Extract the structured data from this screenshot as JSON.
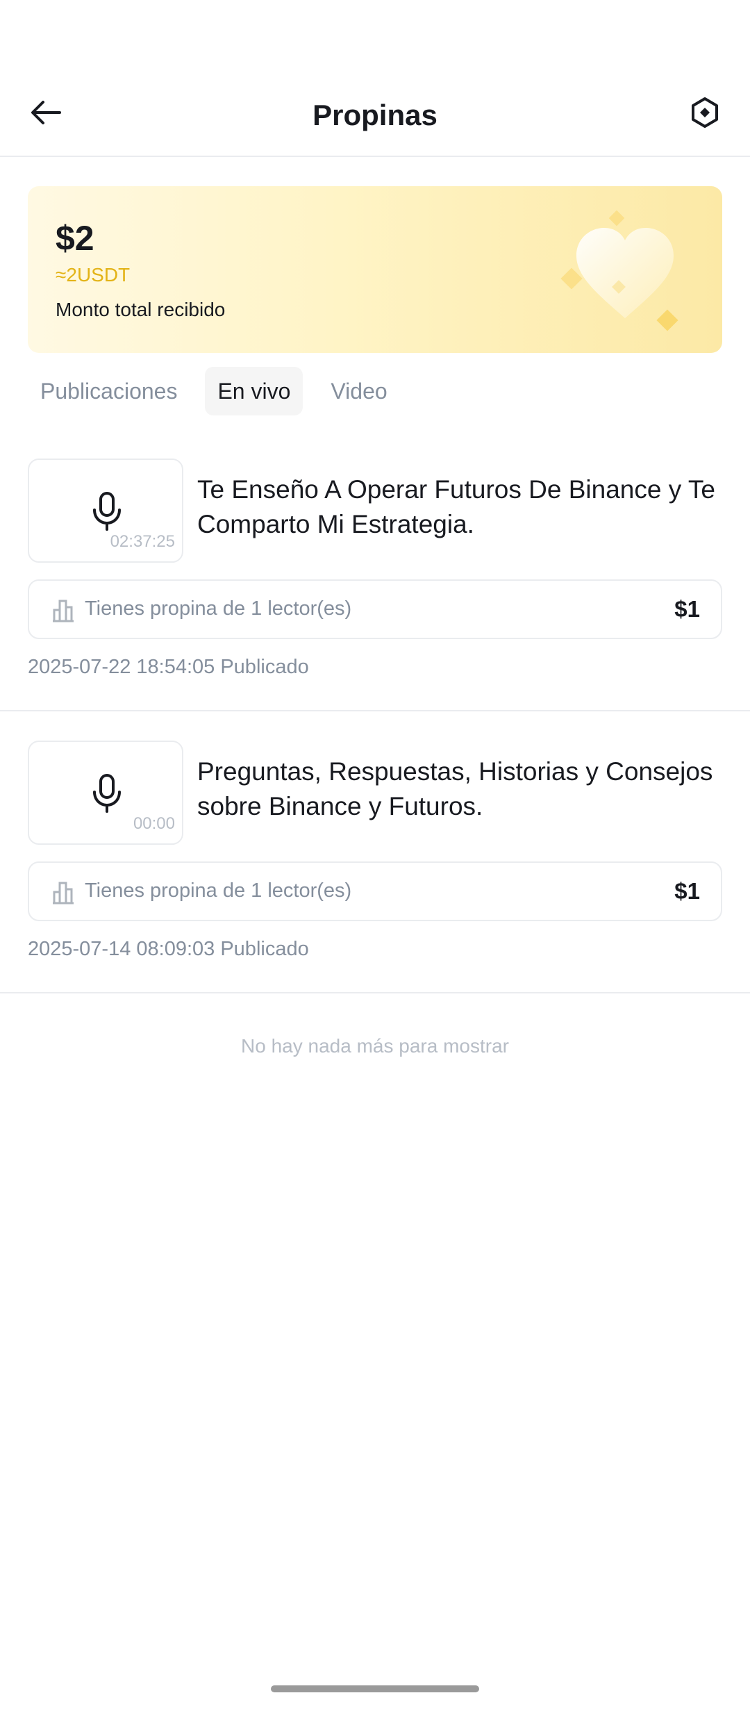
{
  "header": {
    "title": "Propinas",
    "back_icon": "arrow-left-icon",
    "settings_icon": "hexagon-settings-icon"
  },
  "summary": {
    "amount": "$2",
    "usdt": "≈2USDT",
    "label": "Monto total recibido",
    "accent_color": "#e3b316"
  },
  "tabs": [
    {
      "label": "Publicaciones",
      "active": false
    },
    {
      "label": "En vivo",
      "active": true
    },
    {
      "label": "Video",
      "active": false
    }
  ],
  "items": [
    {
      "title": "Te Enseño A Operar Futuros De Binance y Te Comparto Mi Estrategia.",
      "duration": "02:37:25",
      "tip_text": "Tienes propina de 1 lector(es)",
      "tip_amount": "$1",
      "date": "2025-07-22 18:54:05 Publicado"
    },
    {
      "title": "Preguntas, Respuestas, Historias y Consejos sobre Binance y Futuros.",
      "duration": "00:00",
      "tip_text": "Tienes propina de 1 lector(es)",
      "tip_amount": "$1",
      "date": "2025-07-14 08:09:03 Publicado"
    }
  ],
  "end_message": "No hay nada más para mostrar"
}
